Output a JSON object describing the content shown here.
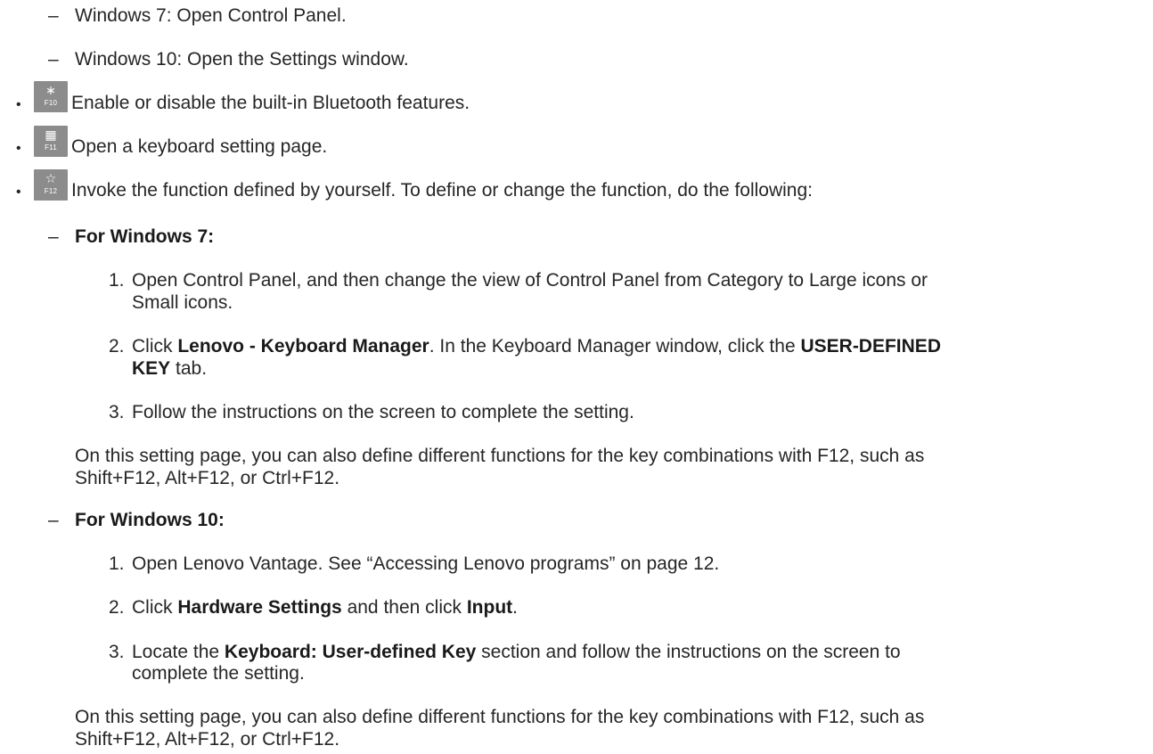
{
  "bullet_char": "•",
  "dash_char": "–",
  "top_items": [
    "Windows 7: Open Control Panel.",
    "Windows 10: Open the Settings window."
  ],
  "f10": {
    "glyph": "∗",
    "label": "F10",
    "text": "Enable or disable the built-in Bluetooth features.",
    "icon": "bluetooth-icon"
  },
  "f11": {
    "glyph": "▦",
    "label": "F11",
    "text": "Open a keyboard setting page.",
    "icon": "keyboard-icon"
  },
  "f12": {
    "glyph": "☆",
    "label": "F12",
    "text": "Invoke the function defined by yourself. To define or change the function, do the following:",
    "icon": "star-icon"
  },
  "win7": {
    "heading": "For Windows 7:",
    "steps": [
      {
        "num": "1.",
        "text1": "Open Control Panel, and then change the view of Control Panel from Category to Large icons or",
        "text2": "Small icons."
      },
      {
        "num": "2.",
        "pre": "Click ",
        "b1": "Lenovo - Keyboard Manager",
        "mid": ". In the Keyboard Manager window, click the ",
        "b2": "USER-DEFINED",
        "b3": "KEY",
        "post": " tab."
      },
      {
        "num": "3.",
        "text1": "Follow the instructions on the screen to complete the setting."
      }
    ],
    "note1": "On this setting page, you can also define different functions for the key combinations with F12, such as",
    "note2": "Shift+F12, Alt+F12, or Ctrl+F12."
  },
  "win10": {
    "heading": "For Windows 10:",
    "steps": [
      {
        "num": "1.",
        "text1": "Open Lenovo Vantage. See “Accessing Lenovo programs” on page 12."
      },
      {
        "num": "2.",
        "pre": "Click ",
        "b1": "Hardware Settings",
        "mid": " and then click ",
        "b2": "Input",
        "post": "."
      },
      {
        "num": "3.",
        "pre": "Locate the ",
        "b1": "Keyboard: User-defined Key",
        "post": " section and follow the instructions on the screen to",
        "text2": "complete the setting."
      }
    ],
    "note1": "On this setting page, you can also define different functions for the key combinations with F12, such as",
    "note2": "Shift+F12, Alt+F12, or Ctrl+F12."
  }
}
